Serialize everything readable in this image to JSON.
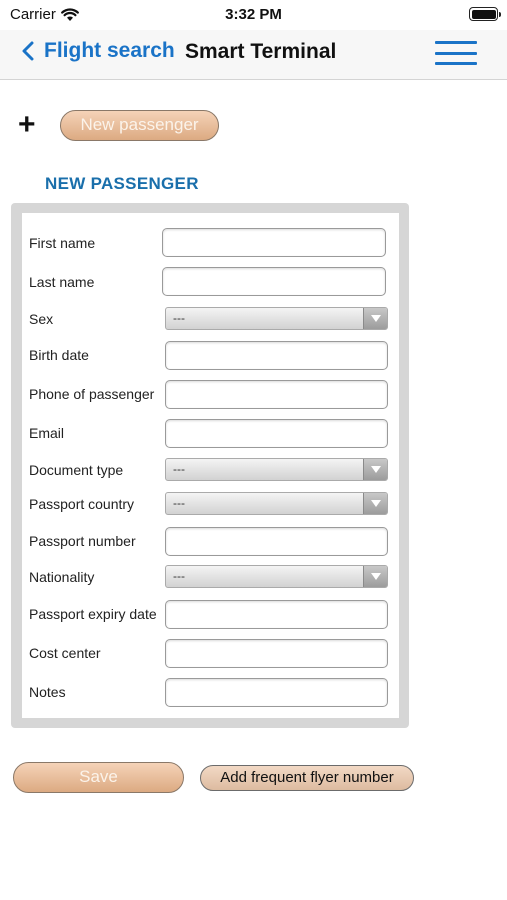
{
  "status_bar": {
    "carrier": "Carrier",
    "time": "3:32 PM"
  },
  "nav": {
    "back_label": "Flight search",
    "title": "Smart Terminal"
  },
  "add_row": {
    "plus": "+",
    "new_passenger_label": "New passenger"
  },
  "form": {
    "title": "NEW PASSENGER",
    "fields": {
      "first_name": {
        "label": "First name",
        "value": ""
      },
      "last_name": {
        "label": "Last name",
        "value": ""
      },
      "sex": {
        "label": "Sex",
        "selected": "---"
      },
      "birth_date": {
        "label": "Birth date",
        "value": ""
      },
      "phone": {
        "label": "Phone of passenger",
        "value": ""
      },
      "email": {
        "label": "Email",
        "value": ""
      },
      "document_type": {
        "label": "Document type",
        "selected": "---"
      },
      "passport_country": {
        "label": "Passport country",
        "selected": "---"
      },
      "passport_number": {
        "label": "Passport number",
        "value": ""
      },
      "nationality": {
        "label": "Nationality",
        "selected": "---"
      },
      "passport_expiry": {
        "label": "Passport expiry date",
        "value": ""
      },
      "cost_center": {
        "label": "Cost center",
        "value": ""
      },
      "notes": {
        "label": "Notes",
        "value": ""
      }
    }
  },
  "actions": {
    "save_label": "Save",
    "frequent_flyer_label": "Add frequent flyer number"
  },
  "colors": {
    "accent_blue": "#1a73c7",
    "section_title": "#1a6fab",
    "button_peach": "#dcaa82"
  }
}
